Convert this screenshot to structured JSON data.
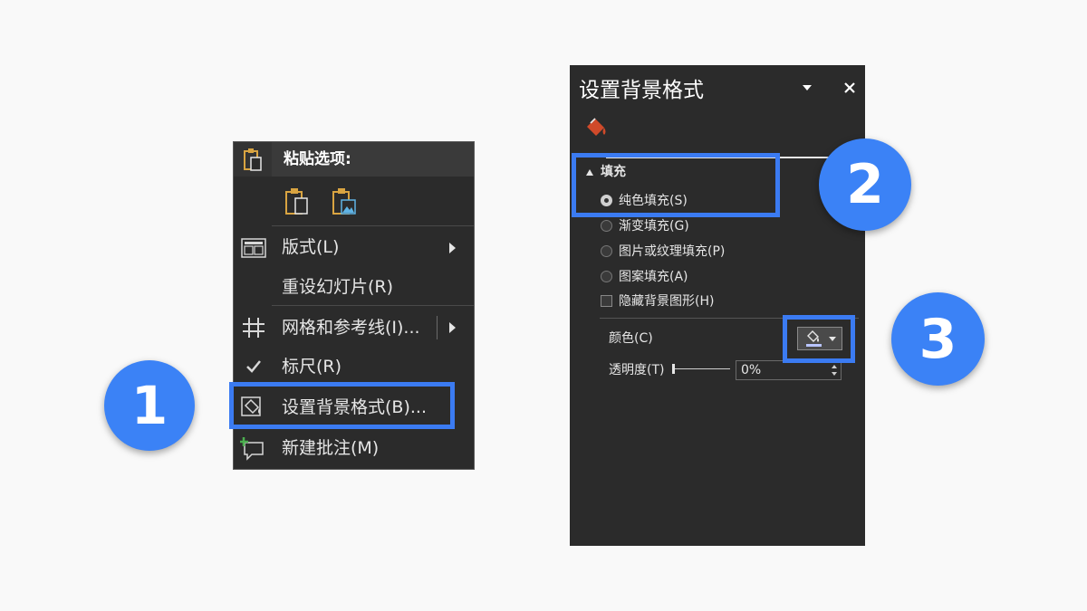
{
  "context_menu": {
    "paste_options_title": "粘贴选项:",
    "items": [
      {
        "label": "版式(L)",
        "icon": "layout-icon",
        "has_submenu": true
      },
      {
        "label": "重设幻灯片(R)",
        "icon": "",
        "has_submenu": false
      },
      {
        "label": "网格和参考线(I)...",
        "icon": "grid-icon",
        "has_submenu": true
      },
      {
        "label": "标尺(R)",
        "icon": "checkmark-icon",
        "has_submenu": false
      },
      {
        "label": "设置背景格式(B)...",
        "icon": "format-background-icon",
        "has_submenu": false
      },
      {
        "label": "新建批注(M)",
        "icon": "new-comment-icon",
        "has_submenu": false
      }
    ]
  },
  "format_panel": {
    "title": "设置背景格式",
    "fill_section": "填充",
    "fill_options": [
      {
        "label": "纯色填充(S)",
        "checked": true
      },
      {
        "label": "渐变填充(G)",
        "checked": false
      },
      {
        "label": "图片或纹理填充(P)",
        "checked": false
      },
      {
        "label": "图案填充(A)",
        "checked": false
      }
    ],
    "hide_bg_graphics": {
      "label": "隐藏背景图形(H)",
      "checked": false
    },
    "color_label": "颜色(C)",
    "transparency_label": "透明度(T)",
    "transparency_value": "0%"
  },
  "steps": [
    "1",
    "2",
    "3"
  ],
  "colors": {
    "accent": "#3b82f6",
    "highlight_border": "#3b7bf2",
    "menu_bg": "#2b2b2b",
    "paint_bucket": "#d04a2a",
    "page_bg": "#f9f9f9"
  }
}
